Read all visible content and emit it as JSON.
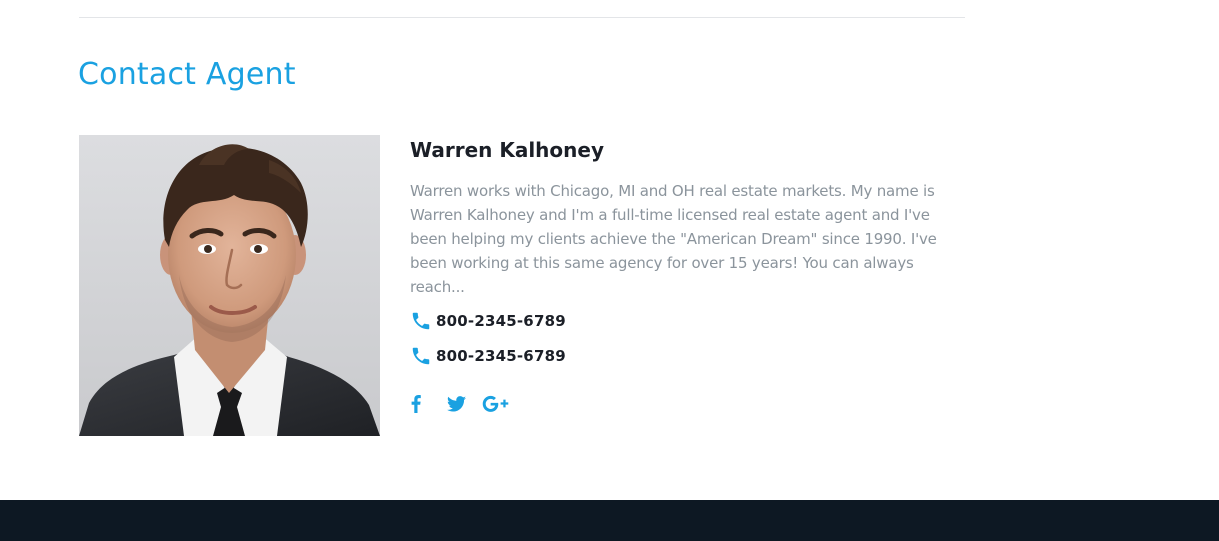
{
  "section": {
    "title": "Contact Agent"
  },
  "agent": {
    "name": "Warren Kalhoney",
    "bio": "Warren works with Chicago, MI and OH real estate markets. My name is Warren Kalhoney and I'm a full-time licensed real estate agent and I've been helping my clients achieve the \"American Dream\" since 1990. I've been working at this same agency for over 15 years! You can always reach...",
    "phones": [
      "800-2345-6789",
      "800-2345-6789"
    ],
    "photo_alt": "Portrait of Warren Kalhoney",
    "social": [
      {
        "name": "facebook",
        "icon": "facebook-icon"
      },
      {
        "name": "twitter",
        "icon": "twitter-icon"
      },
      {
        "name": "google-plus",
        "icon": "google-plus-icon"
      }
    ]
  },
  "colors": {
    "accent": "#1aa1e1",
    "heading": "#1b1f27",
    "body_text": "#8b949c",
    "divider": "#e3e5e8",
    "footer": "#0d1823"
  }
}
